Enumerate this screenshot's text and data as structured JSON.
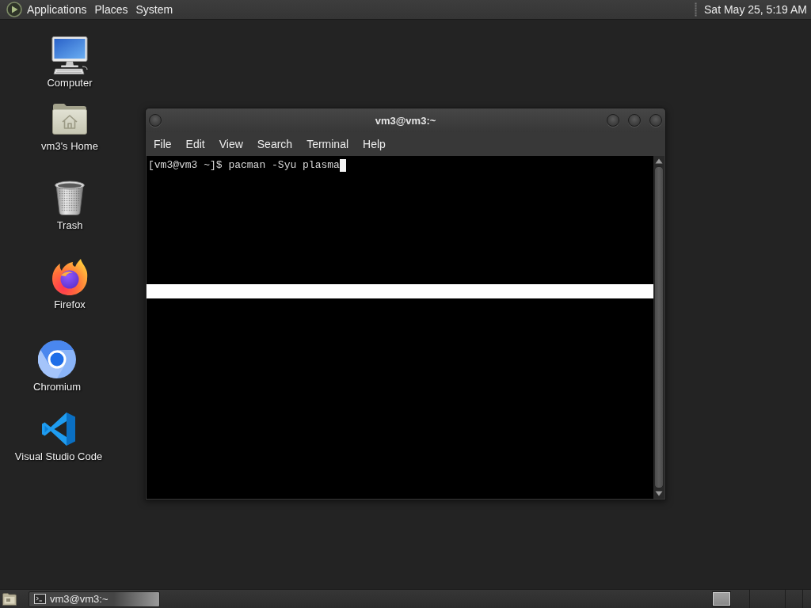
{
  "top_panel": {
    "menus": [
      {
        "label": "Applications"
      },
      {
        "label": "Places"
      },
      {
        "label": "System"
      }
    ],
    "clock": "Sat May 25, 5:19 AM"
  },
  "desktop_icons": [
    {
      "label": "Computer",
      "kind": "computer"
    },
    {
      "label": "vm3's Home",
      "kind": "home"
    },
    {
      "label": "Trash",
      "kind": "trash"
    },
    {
      "label": "Firefox",
      "kind": "firefox"
    },
    {
      "label": "Chromium",
      "kind": "chromium"
    },
    {
      "label": "Visual Studio Code",
      "kind": "vscode"
    }
  ],
  "terminal_window": {
    "title": "vm3@vm3:~",
    "menus": [
      "File",
      "Edit",
      "View",
      "Search",
      "Terminal",
      "Help"
    ],
    "lines": [
      "[vm3@vm3 ~]$ pacman -Syu plasma"
    ]
  },
  "bottom_panel": {
    "tasks": [
      {
        "label": "vm3@vm3:~",
        "selected": true
      }
    ]
  }
}
